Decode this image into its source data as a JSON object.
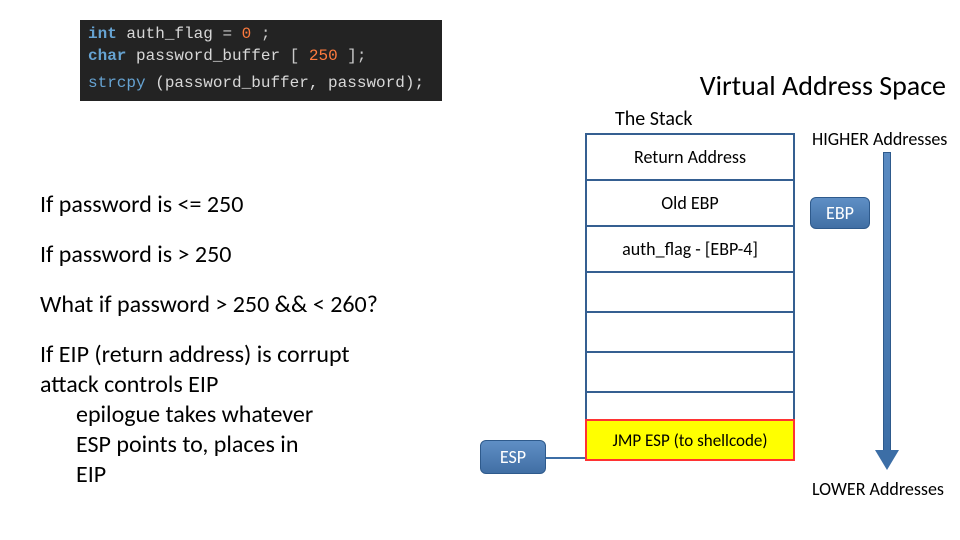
{
  "code": {
    "line1_kw": "int",
    "line1_name": "auth_flag",
    "line1_eq": " = ",
    "line1_val": "0",
    "line1_end": ";",
    "line2_kw": "char",
    "line2_name": "password_buffer",
    "line2_br_open": "[",
    "line2_size": "250",
    "line2_br_close": "];",
    "line3_fn": "strcpy",
    "line3_rest": "(password_buffer, password);"
  },
  "left": {
    "p1": "If password is <= 250",
    "p2": "If password is > 250",
    "p3": "What if password > 250 && < 260?",
    "p4_l1": "If EIP (return address) is corrupt",
    "p4_l2": "attack controls EIP",
    "p4_l3": "epilogue takes whatever",
    "p4_l4": "ESP points to, places in",
    "p4_l5": "EIP"
  },
  "title": "Virtual Address Space",
  "stack_header": "The Stack",
  "higher": "HIGHER Addresses",
  "lower": "LOWER Addresses",
  "stack": {
    "ret": "Return Address",
    "old_ebp": "Old EBP",
    "auth": "auth_flag - [EBP-4]",
    "jmp": "JMP ESP (to shellcode)"
  },
  "pills": {
    "ebp": "EBP",
    "esp": "ESP"
  }
}
